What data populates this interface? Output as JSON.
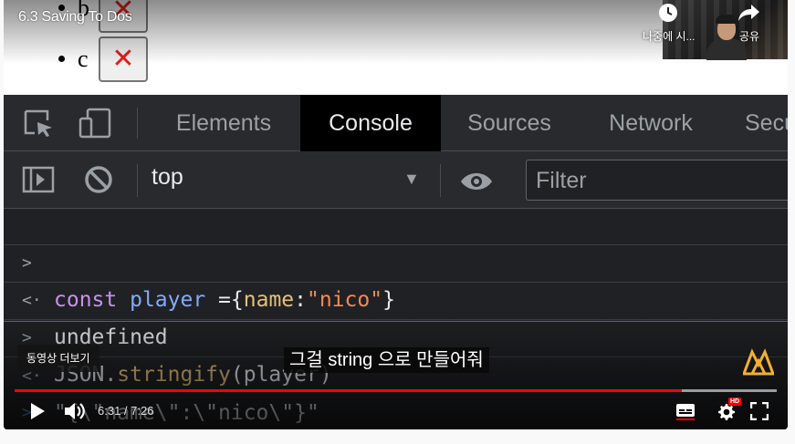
{
  "video": {
    "title": "6.3 Saving To Dos",
    "watch_later_label": "나중에 시...",
    "share_label": "공유",
    "more_videos_label": "동영상 더보기",
    "caption": "그걸 string 으로 만들어줘",
    "time_display": "6:31 / 7:26",
    "progress_played_fraction": 0.876,
    "progress_loaded_fraction": 1.0,
    "hd_badge": "HD"
  },
  "webpage": {
    "list_items": [
      "b",
      "c"
    ]
  },
  "devtools": {
    "tabs": [
      {
        "label": "Elements",
        "active": false
      },
      {
        "label": "Console",
        "active": true
      },
      {
        "label": "Sources",
        "active": false
      },
      {
        "label": "Network",
        "active": false
      },
      {
        "label": "Secu",
        "active": false
      }
    ],
    "context_selector": "top",
    "filter_placeholder": "Filter",
    "console_lines": [
      {
        "prefix": ">",
        "tokens": {
          "kw": "const",
          "var": "player",
          "eq": " ={",
          "key": "name",
          "colon": ":",
          "str": "\"nico\"",
          "close": "}"
        }
      },
      {
        "prefix": "<·",
        "text": "undefined"
      },
      {
        "prefix": ">",
        "tokens": {
          "obj": "JSON",
          "dot": ".",
          "method": "stringify",
          "open": "(",
          "arg": "player",
          "close": ")"
        }
      },
      {
        "prefix": "<·",
        "text": "\"{\\\"name\\\":\\\"nico\\\"}\""
      },
      {
        "prefix": ">",
        "text": ""
      }
    ]
  },
  "colors": {
    "progress_red": "#ff0000",
    "devtools_bg": "#202124",
    "x_red": "#e0201b",
    "channel_logo": "#f2b130"
  }
}
